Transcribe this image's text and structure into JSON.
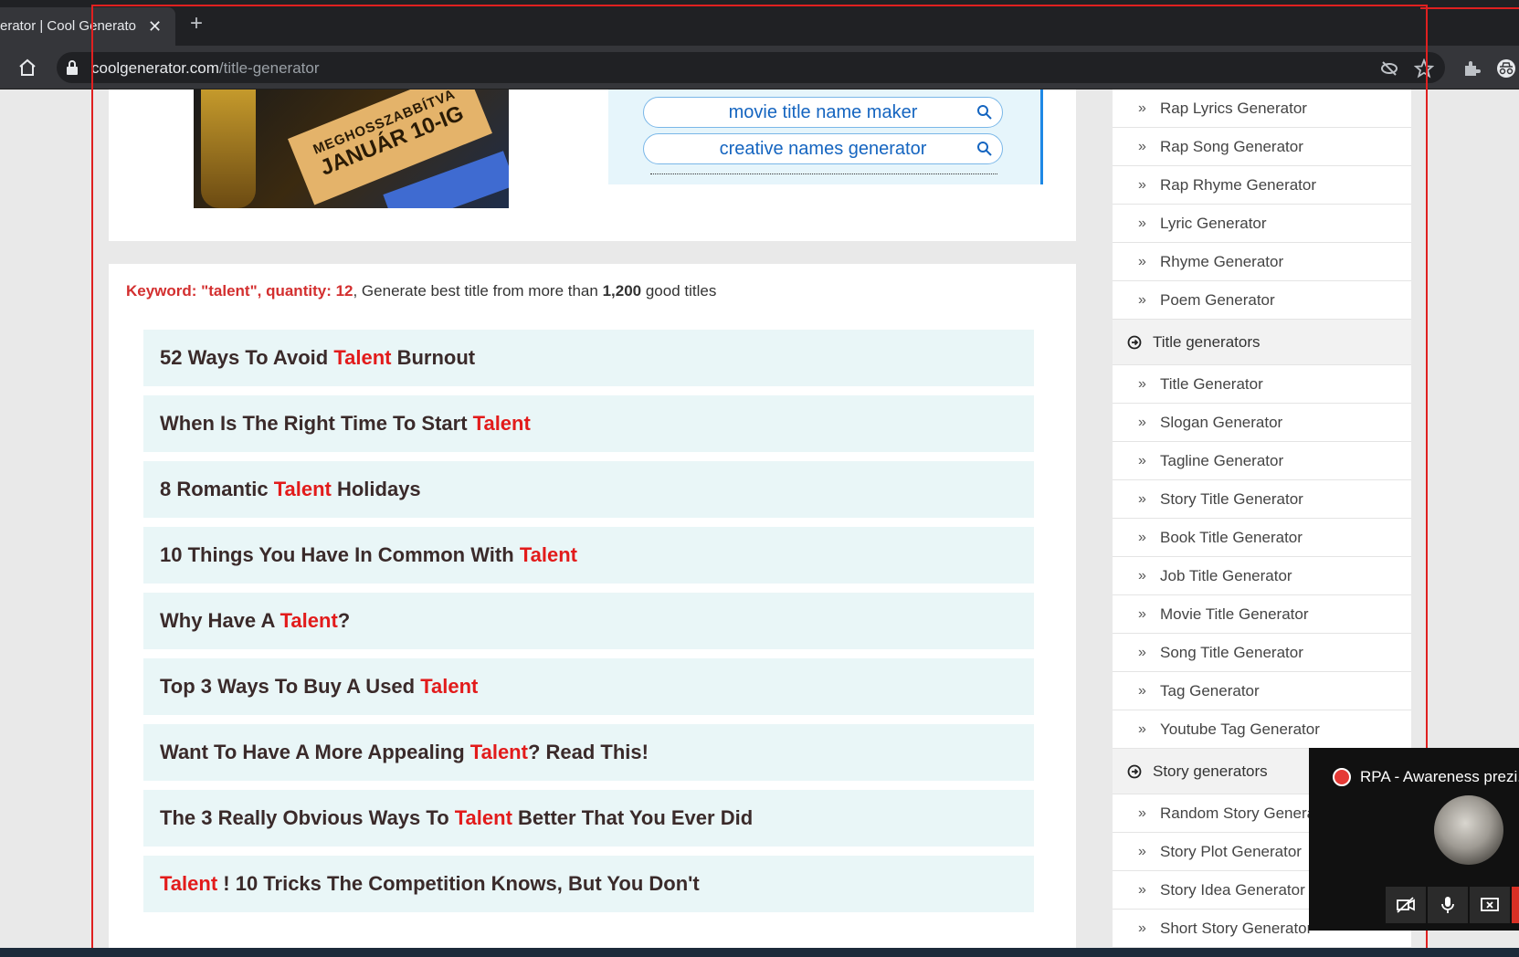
{
  "browser": {
    "tab_title": "erator | Cool Generator",
    "tab_close": "✕",
    "new_tab": "+",
    "url_domain": "coolgenerator.com",
    "url_path": "/title-generator"
  },
  "ad": {
    "line1": "MEGHOSSZABBÍTVA",
    "line2": "JANUÁR 10-IG"
  },
  "search_suggestions": [
    "movie title name maker",
    "creative names generator"
  ],
  "keyword_line": {
    "label": "Keyword: \"talent\", quantity: 12",
    "mid": ", Generate best title from more than ",
    "count": "1,200",
    "tail": " good titles"
  },
  "titles": [
    {
      "pre": "52 Ways To Avoid ",
      "kw": "Talent",
      "post": " Burnout"
    },
    {
      "pre": "When Is The Right Time To Start ",
      "kw": "Talent",
      "post": ""
    },
    {
      "pre": "8 Romantic ",
      "kw": "Talent",
      "post": " Holidays"
    },
    {
      "pre": "10 Things You Have In Common With ",
      "kw": "Talent",
      "post": ""
    },
    {
      "pre": "Why Have A ",
      "kw": "Talent",
      "post": "?"
    },
    {
      "pre": "Top 3 Ways To Buy A Used ",
      "kw": "Talent",
      "post": ""
    },
    {
      "pre": "Want To Have A More Appealing ",
      "kw": "Talent",
      "post": "? Read This!"
    },
    {
      "pre": "The 3 Really Obvious Ways To ",
      "kw": "Talent",
      "post": " Better That You Ever Did"
    },
    {
      "pre": "",
      "kw": "Talent",
      "post": " ! 10 Tricks The Competition Knows, But You Don't"
    }
  ],
  "sidebar": {
    "group1": [
      "Rap Lyrics Generator",
      "Rap Song Generator",
      "Rap Rhyme Generator",
      "Lyric Generator",
      "Rhyme Generator",
      "Poem Generator"
    ],
    "title_header": "Title generators",
    "group2": [
      "Title Generator",
      "Slogan Generator",
      "Tagline Generator",
      "Story Title Generator",
      "Book Title Generator",
      "Job Title Generator",
      "Movie Title Generator",
      "Song Title Generator",
      "Tag Generator",
      "Youtube Tag Generator"
    ],
    "story_header": "Story generators",
    "group3": [
      "Random Story Generator",
      "Story Plot Generator",
      "Story Idea Generator",
      "Short Story Generator"
    ]
  },
  "meet": {
    "title": "RPA - Awareness prezi..."
  },
  "colors": {
    "highlight": "#e21b1b",
    "title_bg": "#e9f6f7",
    "frame": "#e02020"
  }
}
